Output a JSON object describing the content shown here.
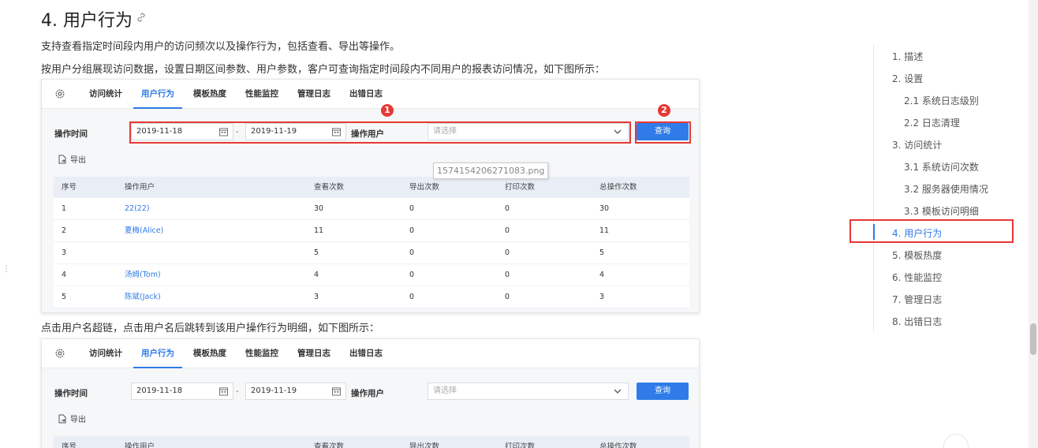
{
  "article": {
    "title": "4. 用户行为",
    "para1": "支持查看指定时间段内用户的访问频次以及操作行为，包括查看、导出等操作。",
    "para2": "按用户分组展现访问数据，设置日期区间参数、用户参数，客户可查询指定时间段内不同用户的报表访问情况，如下图所示：",
    "para3": "点击用户名超链，点击用户名后跳转到该用户操作行为明细，如下图所示："
  },
  "shot": {
    "tabs": [
      "访问统计",
      "用户行为",
      "模板热度",
      "性能监控",
      "管理日志",
      "出错日志"
    ],
    "active_tab": "用户行为",
    "filter": {
      "time_label": "操作时间",
      "date_from": "2019-11-18",
      "date_to": "2019-11-19",
      "dash": "-",
      "user_label": "操作用户",
      "user_placeholder": "请选择",
      "query_label": "查询"
    },
    "export_label": "导出",
    "table": {
      "headers": [
        "序号",
        "操作用户",
        "查看次数",
        "导出次数",
        "打印次数",
        "总操作次数"
      ],
      "rows": [
        [
          "1",
          "22(22)",
          "30",
          "0",
          "0",
          "30"
        ],
        [
          "2",
          "夏梅(Alice)",
          "11",
          "0",
          "0",
          "11"
        ],
        [
          "3",
          "",
          "5",
          "0",
          "0",
          "5"
        ],
        [
          "4",
          "汤姆(Tom)",
          "4",
          "0",
          "0",
          "4"
        ],
        [
          "5",
          "陈斌(Jack)",
          "3",
          "0",
          "0",
          "3"
        ]
      ]
    }
  },
  "annotations": {
    "badge1": "1",
    "badge2": "2",
    "tooltip": "1574154206271083.png"
  },
  "toc": {
    "items": [
      {
        "label": "1. 描述",
        "level": 1
      },
      {
        "label": "2. 设置",
        "level": 1
      },
      {
        "label": "2.1 系统日志级别",
        "level": 2
      },
      {
        "label": "2.2 日志清理",
        "level": 2
      },
      {
        "label": "3. 访问统计",
        "level": 1
      },
      {
        "label": "3.1 系统访问次数",
        "level": 2
      },
      {
        "label": "3.2 服务器使用情况",
        "level": 2
      },
      {
        "label": "3.3 模板访问明细",
        "level": 2
      },
      {
        "label": "4. 用户行为",
        "level": 1,
        "active": true
      },
      {
        "label": "5. 模板热度",
        "level": 1
      },
      {
        "label": "6. 性能监控",
        "level": 1
      },
      {
        "label": "7. 管理日志",
        "level": 1
      },
      {
        "label": "8. 出错日志",
        "level": 1
      }
    ]
  },
  "colors": {
    "accent": "#2f7ce8",
    "annotation_red": "#e53935"
  }
}
